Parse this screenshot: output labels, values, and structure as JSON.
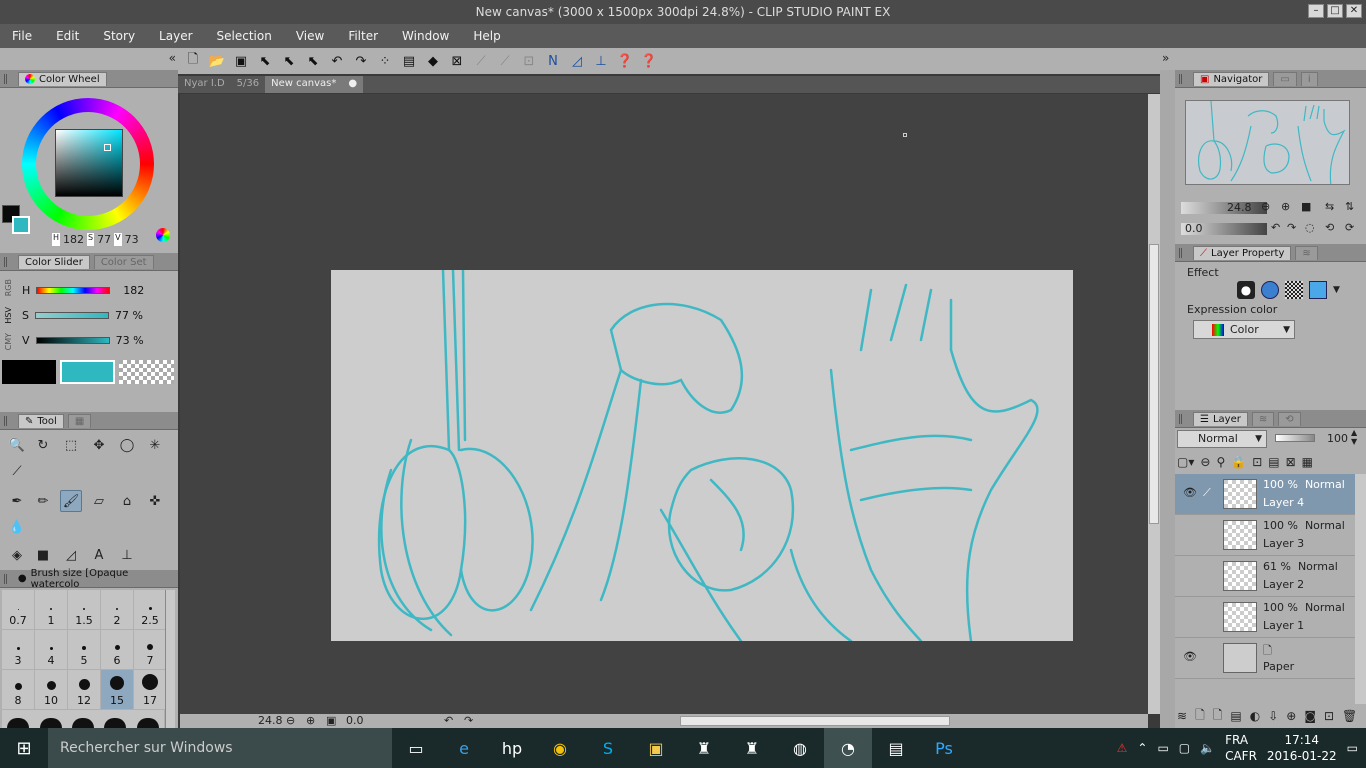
{
  "window": {
    "title": "New canvas* (3000 x 1500px 300dpi 24.8%)  - CLIP STUDIO PAINT EX"
  },
  "menu": [
    "File",
    "Edit",
    "Story",
    "Layer",
    "Selection",
    "View",
    "Filter",
    "Window",
    "Help"
  ],
  "color_wheel": {
    "tab": "Color Wheel",
    "h_label": "H",
    "h_value": "182",
    "s_label": "S",
    "s_value": "77",
    "v_label": "V",
    "v_value": "73",
    "main_color": "#2fb8c0"
  },
  "color_slider": {
    "tab": "Color Slider",
    "tab2": "Color Set",
    "side_tabs": [
      "RGB",
      "HSV",
      "CMY"
    ],
    "rows": [
      {
        "label": "H",
        "value": "182"
      },
      {
        "label": "S",
        "value": "77 %"
      },
      {
        "label": "V",
        "value": "73 %"
      }
    ]
  },
  "tool": {
    "tab": "Tool"
  },
  "brush_size": {
    "tab": "Brush size [Opaque watercolo",
    "sizes": [
      "0.7",
      "1",
      "1.5",
      "2",
      "2.5",
      "3",
      "4",
      "5",
      "6",
      "7",
      "8",
      "10",
      "12",
      "15",
      "17"
    ],
    "selected": "15"
  },
  "doc_tabs": [
    {
      "name": "Nyar I.D",
      "pages": "5/36"
    },
    {
      "name": "New canvas*",
      "pages": ""
    }
  ],
  "status": {
    "zoom": "24.8",
    "rotation": "0.0"
  },
  "navigator": {
    "tab": "Navigator",
    "zoom": "24.8",
    "rotation": "0.0"
  },
  "layer_property": {
    "tab": "Layer Property",
    "effect_label": "Effect",
    "expression_label": "Expression color",
    "expression_value": "Color"
  },
  "layer_panel": {
    "tab": "Layer",
    "blend_mode": "Normal",
    "opacity": "100",
    "layers": [
      {
        "opacity": "100 %",
        "mode": "Normal",
        "name": "Layer 4",
        "selected": true
      },
      {
        "opacity": "100 %",
        "mode": "Normal",
        "name": "Layer 3",
        "selected": false
      },
      {
        "opacity": "61 %",
        "mode": "Normal",
        "name": "Layer 2",
        "selected": false
      },
      {
        "opacity": "100 %",
        "mode": "Normal",
        "name": "Layer 1",
        "selected": false
      }
    ],
    "paper": "Paper"
  },
  "taskbar": {
    "search_placeholder": "Rechercher sur Windows",
    "lang1": "FRA",
    "lang2": "CAFR",
    "time": "17:14",
    "date": "2016-01-22"
  },
  "colors": {
    "accent": "#2fb8c0",
    "sketch": "#3fb8c4"
  }
}
